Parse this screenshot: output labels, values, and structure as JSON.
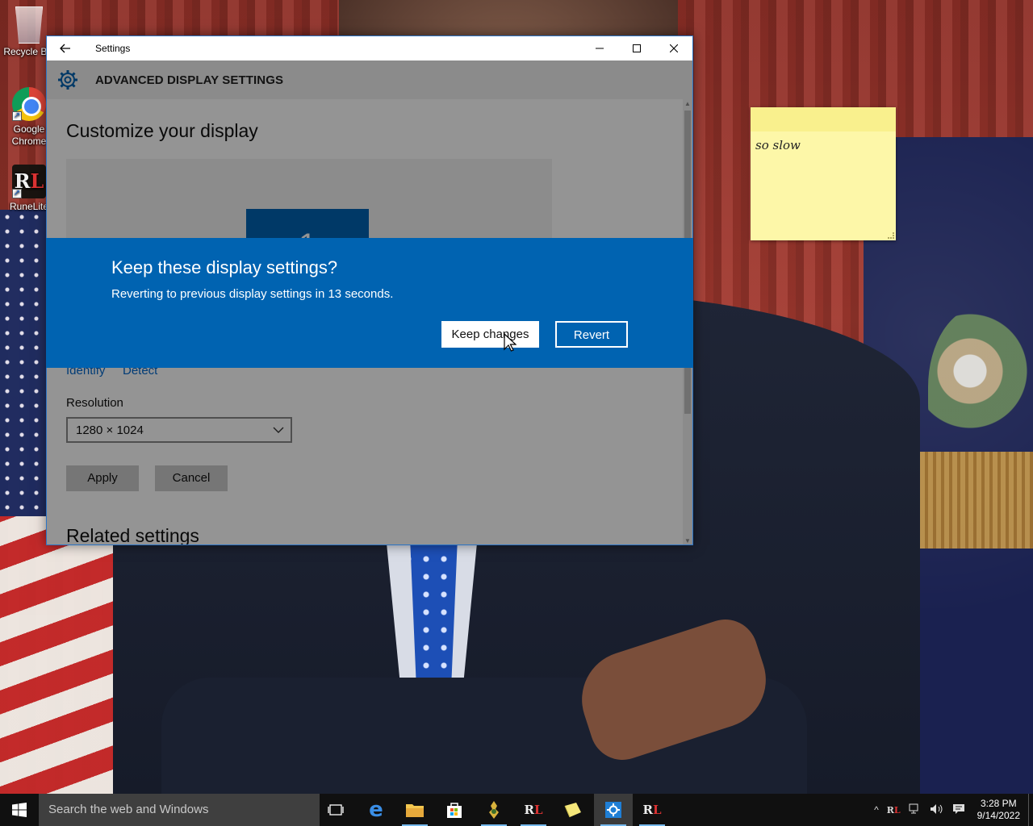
{
  "desktop": {
    "icons": [
      {
        "label": "Recycle Bin",
        "icon": "recycle-bin-icon"
      },
      {
        "label": "Google Chrome",
        "icon": "chrome-icon"
      },
      {
        "label": "RuneLite",
        "icon": "runelite-icon"
      }
    ]
  },
  "sticky_note": {
    "text": "so slow",
    "color": "#fdf7a8"
  },
  "settings_window": {
    "title": "Settings",
    "header": "ADVANCED DISPLAY SETTINGS",
    "heading": "Customize your display",
    "identify": "Identify",
    "detect": "Detect",
    "resolution_label": "Resolution",
    "resolution_value": "1280 × 1024",
    "apply": "Apply",
    "cancel": "Cancel",
    "related": "Related settings",
    "accent": "#0063b1"
  },
  "dialog": {
    "title": "Keep these display settings?",
    "message": "Reverting to previous display settings in 13 seconds.",
    "keep": "Keep changes",
    "revert": "Revert"
  },
  "taskbar": {
    "search_placeholder": "Search the web and Windows",
    "apps": [
      "task-view-icon",
      "edge-icon",
      "file-explorer-icon",
      "store-icon",
      "rs-icon",
      "runelite-icon",
      "sticky-notes-icon",
      "settings-icon",
      "runelite-icon"
    ],
    "time": "3:28 PM",
    "date": "9/14/2022"
  }
}
